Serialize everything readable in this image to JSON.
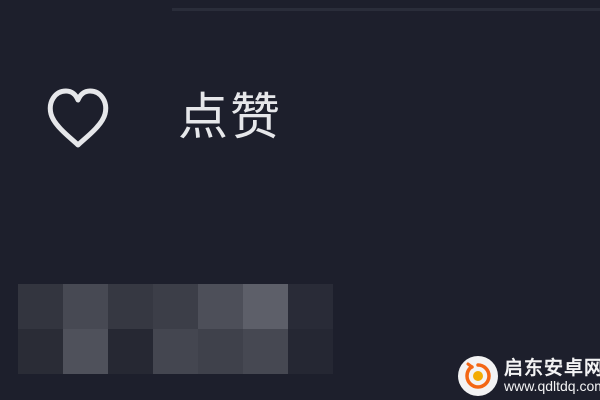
{
  "menu": {
    "like": {
      "icon": "heart-icon",
      "label": "点赞"
    }
  },
  "watermark": {
    "title": "启东安卓网",
    "url": "www.qdltdq.com"
  },
  "colors": {
    "background": "#1d1f2c",
    "text": "#e6e7ea",
    "icon": "#e6e7ea",
    "watermark_accent": "#ff6a13"
  }
}
